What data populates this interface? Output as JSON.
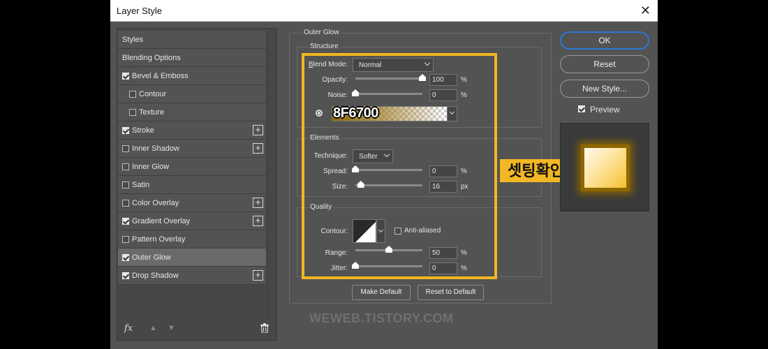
{
  "dialog": {
    "title": "Layer Style"
  },
  "styles_list": [
    {
      "label": "Styles",
      "checkbox": false,
      "checked": false,
      "plus": false,
      "indent": false,
      "selected": false
    },
    {
      "label": "Blending Options",
      "checkbox": false,
      "checked": false,
      "plus": false,
      "indent": false,
      "selected": false
    },
    {
      "label": "Bevel & Emboss",
      "checkbox": true,
      "checked": true,
      "plus": false,
      "indent": false,
      "selected": false
    },
    {
      "label": "Contour",
      "checkbox": true,
      "checked": false,
      "plus": false,
      "indent": true,
      "selected": false
    },
    {
      "label": "Texture",
      "checkbox": true,
      "checked": false,
      "plus": false,
      "indent": true,
      "selected": false
    },
    {
      "label": "Stroke",
      "checkbox": true,
      "checked": true,
      "plus": true,
      "indent": false,
      "selected": false
    },
    {
      "label": "Inner Shadow",
      "checkbox": true,
      "checked": false,
      "plus": true,
      "indent": false,
      "selected": false
    },
    {
      "label": "Inner Glow",
      "checkbox": true,
      "checked": false,
      "plus": false,
      "indent": false,
      "selected": false
    },
    {
      "label": "Satin",
      "checkbox": true,
      "checked": false,
      "plus": false,
      "indent": false,
      "selected": false
    },
    {
      "label": "Color Overlay",
      "checkbox": true,
      "checked": false,
      "plus": true,
      "indent": false,
      "selected": false
    },
    {
      "label": "Gradient Overlay",
      "checkbox": true,
      "checked": true,
      "plus": true,
      "indent": false,
      "selected": false
    },
    {
      "label": "Pattern Overlay",
      "checkbox": true,
      "checked": false,
      "plus": false,
      "indent": false,
      "selected": false
    },
    {
      "label": "Outer Glow",
      "checkbox": true,
      "checked": true,
      "plus": false,
      "indent": false,
      "selected": true
    },
    {
      "label": "Drop Shadow",
      "checkbox": true,
      "checked": true,
      "plus": true,
      "indent": false,
      "selected": false
    }
  ],
  "footer": {
    "fx_label": "fx"
  },
  "outer_glow": {
    "title": "Outer Glow",
    "structure": {
      "title": "Structure",
      "blend_mode_label": "Blend Mode:",
      "blend_mode_value": "Normal",
      "opacity_label": "Opacity:",
      "opacity_value": "100",
      "opacity_level": 1.0,
      "noise_label": "Noise:",
      "noise_value": "0",
      "noise_level": 0.0,
      "percent": "%",
      "glow_color_hex": "8F6700",
      "glow_color": "#8f6700"
    },
    "elements": {
      "title": "Elements",
      "technique_label": "Technique:",
      "technique_value": "Softer",
      "spread_label": "Spread:",
      "spread_value": "0",
      "spread_level": 0.0,
      "size_label": "Size:",
      "size_value": "16",
      "size_level": 0.08,
      "px": "px"
    },
    "quality": {
      "title": "Quality",
      "contour_label": "Contour:",
      "anti_aliased_label": "Anti-aliased",
      "range_label": "Range:",
      "range_value": "50",
      "range_level": 0.5,
      "jitter_label": "Jitter:",
      "jitter_value": "0",
      "jitter_level": 0.0
    },
    "make_default_label": "Make Default",
    "reset_default_label": "Reset to Default"
  },
  "annotation": {
    "callout_text": "셋팅확인",
    "highlight_color": "#f2b723"
  },
  "watermark": "WEWEB.TISTORY.COM",
  "right": {
    "ok_label": "OK",
    "reset_label": "Reset",
    "new_style_label": "New Style...",
    "preview_label": "Preview",
    "preview_checked": true
  }
}
